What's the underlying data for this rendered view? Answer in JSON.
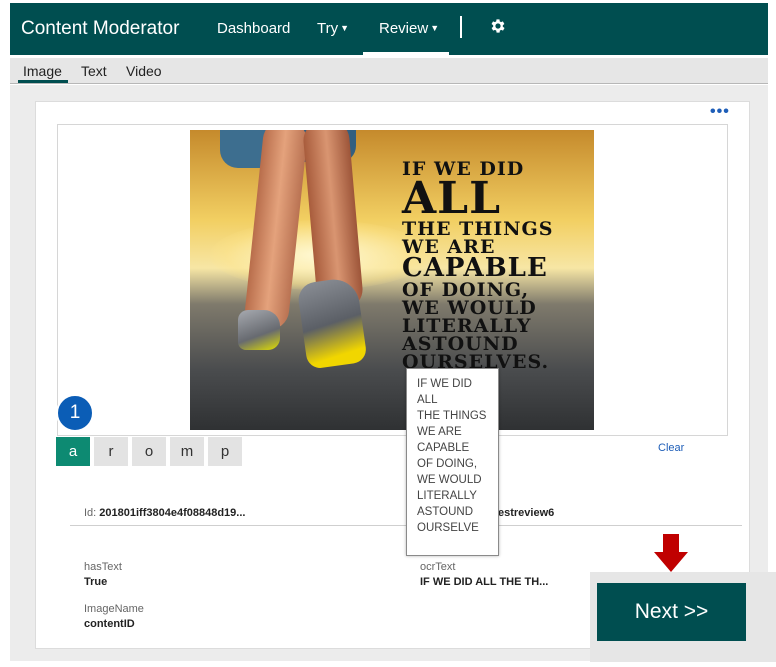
{
  "app": {
    "brand": "Content Moderator",
    "nav": [
      {
        "label": "Dashboard"
      },
      {
        "label": "Try"
      },
      {
        "label": "Review"
      }
    ],
    "settings_icon": "gear-icon"
  },
  "subnav": {
    "tabs": [
      {
        "label": "Image"
      },
      {
        "label": "Text"
      },
      {
        "label": "Video"
      }
    ],
    "active": "Image"
  },
  "review": {
    "more_label": "•••",
    "image_text": [
      "IF WE DID",
      "ALL",
      "THE THINGS",
      "WE ARE",
      "CAPABLE",
      "OF DOING,",
      "WE WOULD",
      "LITERALLY",
      "ASTOUND",
      "OURSELVES."
    ],
    "badge": "1",
    "tags": [
      {
        "label": "a",
        "active": true
      },
      {
        "label": "r"
      },
      {
        "label": "o"
      },
      {
        "label": "m"
      },
      {
        "label": "p"
      }
    ],
    "clear_label": "Clear",
    "id_label": "Id:",
    "id_value": "201801iff3804e4f08848d19...",
    "id_right": "estreview6",
    "metadata": [
      {
        "key": "hasText",
        "value": "True"
      },
      {
        "key": "ocrText",
        "value": "IF WE DID ALL THE TH..."
      },
      {
        "key": "ImageName",
        "value": "contentID"
      }
    ],
    "tooltip_lines": [
      "IF WE DID",
      "ALL",
      "THE THINGS",
      "WE ARE",
      "CAPABLE",
      "OF DOING,",
      "WE WOULD",
      "LITERALLY",
      "ASTOUND",
      "OURSELVE"
    ],
    "next_label": "Next >>",
    "accent_color": "#004e50",
    "tag_active_color": "#0d8a72",
    "arrow_color": "#c00000"
  }
}
